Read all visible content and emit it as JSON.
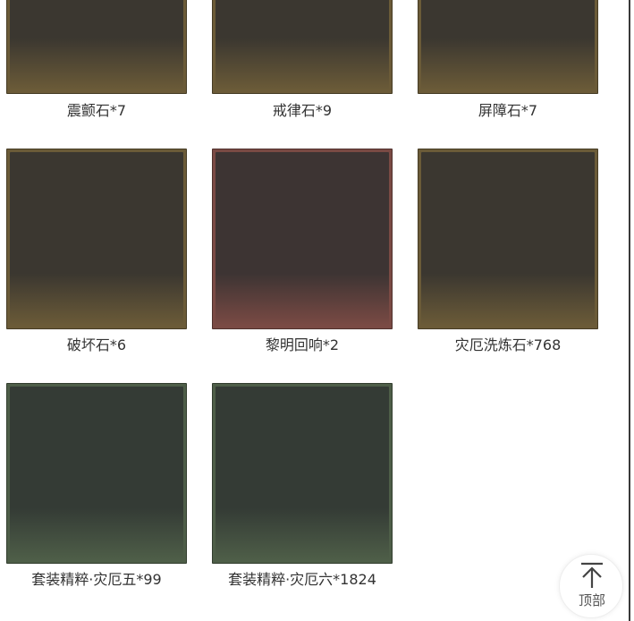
{
  "items": [
    {
      "label": "震颤石*7",
      "tone": "gold",
      "frame_color": "#6b5b38",
      "inner_color": "#3b3730"
    },
    {
      "label": "戒律石*9",
      "tone": "gold",
      "frame_color": "#6b5b38",
      "inner_color": "#3b3730"
    },
    {
      "label": "屏障石*7",
      "tone": "gold",
      "frame_color": "#6b5b38",
      "inner_color": "#3b3730"
    },
    {
      "label": "破坏石*6",
      "tone": "gold",
      "frame_color": "#6b5b38",
      "inner_color": "#3b3730"
    },
    {
      "label": "黎明回响*2",
      "tone": "red",
      "frame_color": "#7a4a44",
      "inner_color": "#3d3433"
    },
    {
      "label": "灾厄洗炼石*768",
      "tone": "gold",
      "frame_color": "#6b5b38",
      "inner_color": "#3b3730"
    },
    {
      "label": "套装精粹·灾厄五*99",
      "tone": "green",
      "frame_color": "#4e5e48",
      "inner_color": "#343b35"
    },
    {
      "label": "套装精粹·灾厄六*1824",
      "tone": "green",
      "frame_color": "#4e5e48",
      "inner_color": "#343b35"
    }
  ],
  "back_to_top": {
    "label": "顶部",
    "icon": "arrow-up-to-top-icon"
  }
}
